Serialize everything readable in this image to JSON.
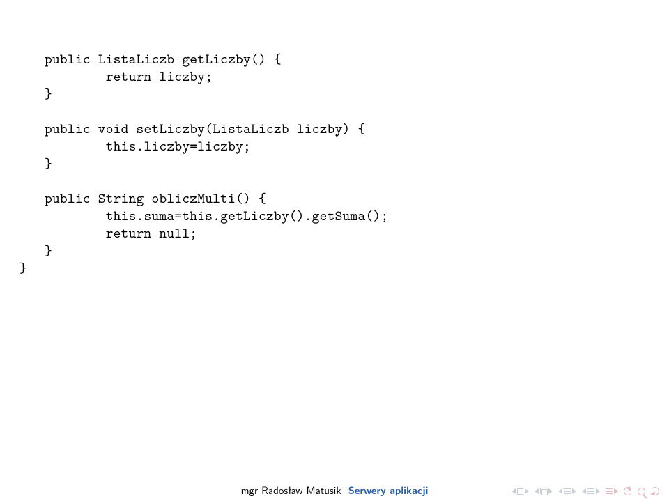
{
  "code": {
    "l1": "public ListaLiczb getLiczby() {",
    "l2": "        return liczby;",
    "l3": "}",
    "l4": "",
    "l5": "public void setLiczby(ListaLiczb liczby) {",
    "l6": "        this.liczby=liczby;",
    "l7": "}",
    "l8": "",
    "l9": "public String obliczMulti() {",
    "l10": "        this.suma=this.getLiczby().getSuma();",
    "l11": "        return null;",
    "l12": "}",
    "close": "}"
  },
  "footer": {
    "author": "mgr Radosław Matusik",
    "title": "Serwery aplikacji"
  },
  "nav": {
    "first": "nav-first",
    "prev_sub": "nav-prev-subsection",
    "prev": "nav-prev",
    "next": "nav-next",
    "last": "nav-last",
    "undo": "nav-undo",
    "redo": "nav-redo",
    "search": "nav-search"
  }
}
